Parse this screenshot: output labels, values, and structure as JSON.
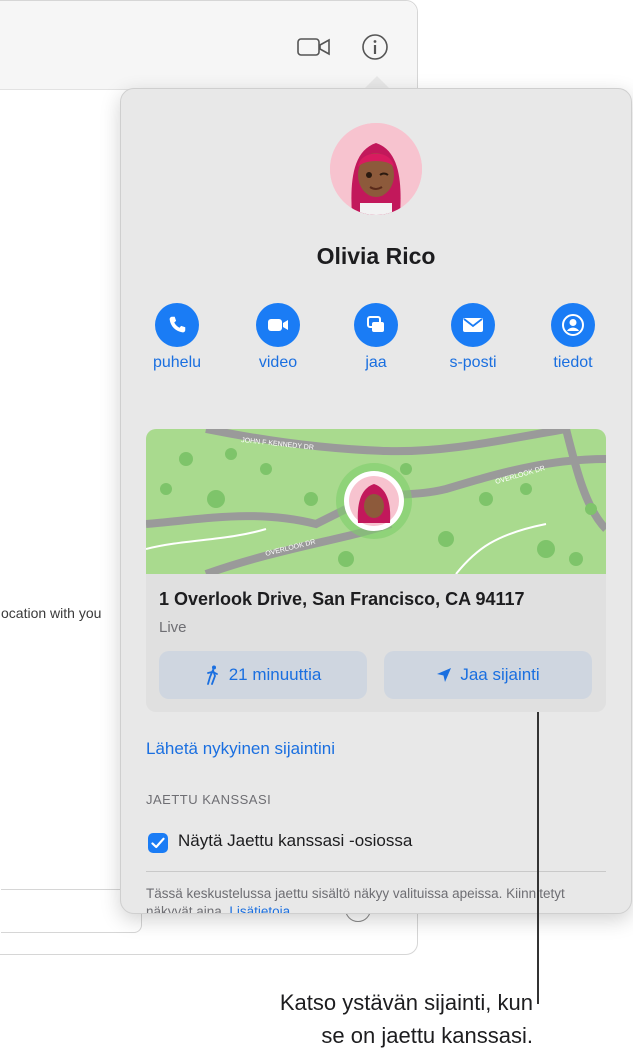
{
  "contact": {
    "name": "Olivia Rico"
  },
  "actions": [
    {
      "label": "puhelu",
      "icon": "phone-icon"
    },
    {
      "label": "video",
      "icon": "video-camera-icon"
    },
    {
      "label": "jaa",
      "icon": "share-screen-icon"
    },
    {
      "label": "s-posti",
      "icon": "mail-icon"
    },
    {
      "label": "tiedot",
      "icon": "person-icon"
    }
  ],
  "location": {
    "map_streets": [
      "JOHN F KENNEDY DR",
      "OVERLOOK DR",
      "OVERLOOK DR"
    ],
    "address": "1 Overlook Drive, San Francisco, CA 94117",
    "status": "Live",
    "walk_button": "21 minuuttia",
    "share_button": "Jaa sijainti"
  },
  "send_current_location": "Lähetä nykyinen sijaintini",
  "shared_with_you": {
    "heading": "JAETTU KANSSASI",
    "checkbox_label": "Näytä Jaettu kanssasi -osiossa",
    "checked": true,
    "footer_text": "Tässä keskustelussa jaettu sisältö näkyy valituissa apeissa. Kiinnitetyt näkyvät aina.",
    "footer_link": "Lisätietoja"
  },
  "background": {
    "partial_text": "ocation with you"
  },
  "callout": {
    "line1": "Katso ystävän sijainti, kun",
    "line2": "se on jaettu kanssasi."
  },
  "colors": {
    "accent": "#1a7cf5",
    "popover_bg": "#e8e8e8",
    "map_green": "#a4d88a"
  }
}
